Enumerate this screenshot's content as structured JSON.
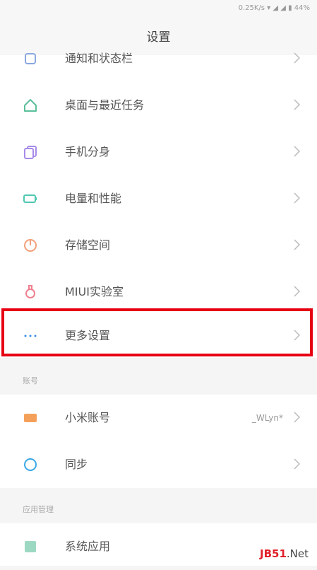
{
  "status_bar": {
    "text": "0.25K/s ▾ ◢ ◢ ▮ 44%"
  },
  "title": "设置",
  "items": [
    {
      "label": "通知和状态栏",
      "icon": "notification-icon"
    },
    {
      "label": "桌面与最近任务",
      "icon": "home-icon"
    },
    {
      "label": "手机分身",
      "icon": "clone-icon"
    },
    {
      "label": "电量和性能",
      "icon": "battery-icon"
    },
    {
      "label": "存储空间",
      "icon": "storage-icon"
    },
    {
      "label": "MIUI实验室",
      "icon": "lab-flask-icon"
    },
    {
      "label": "更多设置",
      "icon": "more-dots-icon"
    }
  ],
  "sections": {
    "account": {
      "header": "账号",
      "items": [
        {
          "label": "小米账号",
          "value": "_WLyn*",
          "icon": "mi-account-icon"
        },
        {
          "label": "同步",
          "icon": "sync-icon"
        }
      ]
    },
    "apps": {
      "header": "应用管理",
      "items": [
        {
          "label": "系统应用",
          "icon": "system-apps-icon"
        }
      ]
    }
  },
  "watermark": {
    "text_a": "JB51",
    "text_b": ".Net"
  },
  "colors": {
    "highlight": "#e60012",
    "home": "#5bbf9a",
    "clone": "#a88be8",
    "battery": "#4fc7b0",
    "storage": "#f3a07a",
    "lab": "#f08090",
    "more": "#3a8ee6",
    "mi": "#f5a05a",
    "sync": "#3aa7e8",
    "system_apps": "#5bbf9a"
  }
}
